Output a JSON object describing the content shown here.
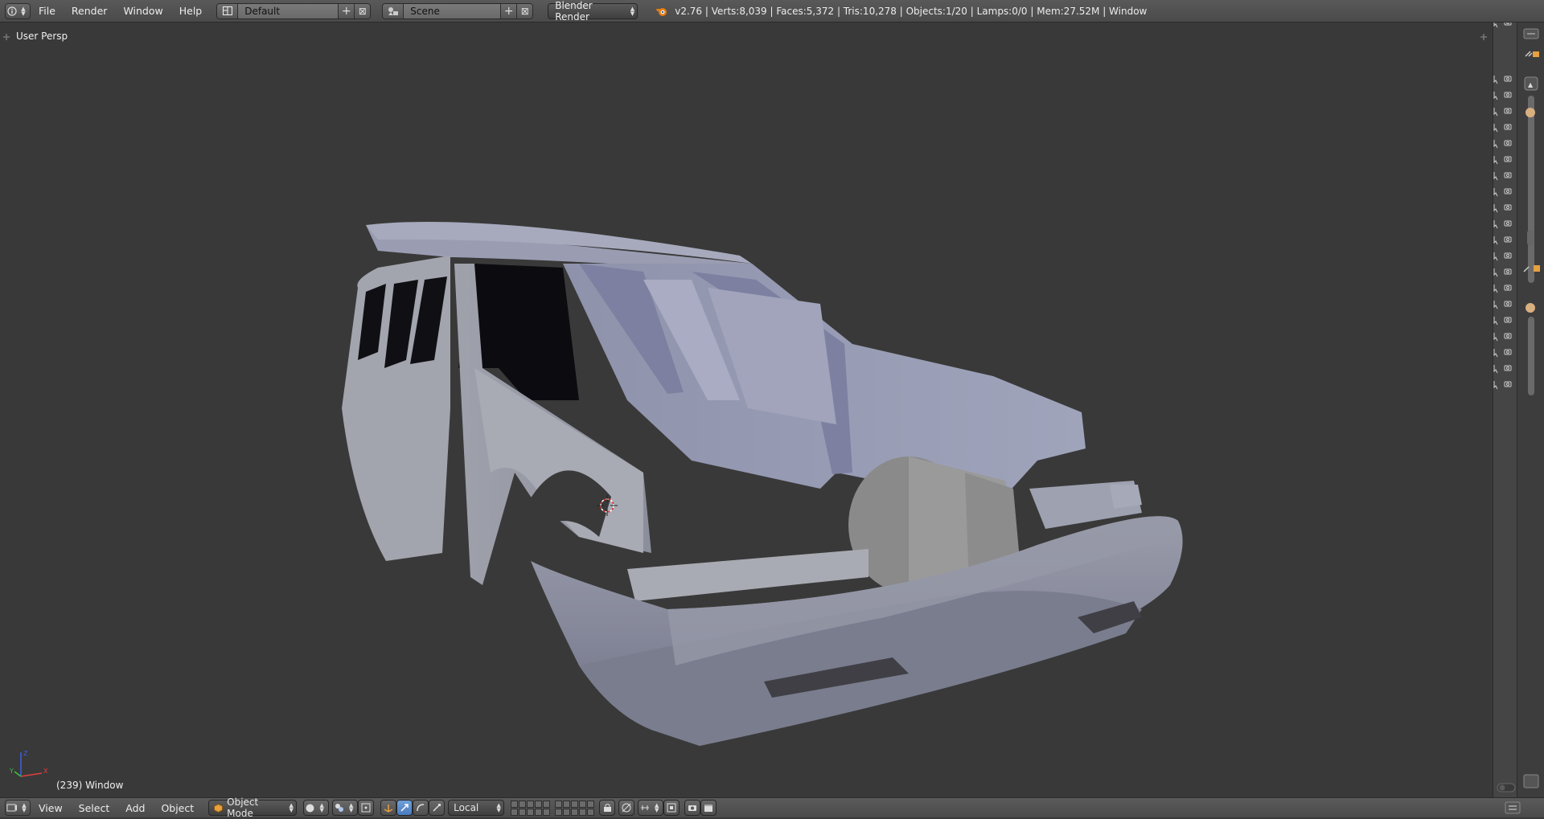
{
  "header": {
    "menus": [
      "File",
      "Render",
      "Window",
      "Help"
    ],
    "screen_layout": "Default",
    "scene": "Scene",
    "render_engine": "Blender Render",
    "stats": "v2.76 | Verts:8,039 | Faces:5,372 | Tris:10,278 | Objects:1/20 | Lamps:0/0 | Mem:27.52M | Window"
  },
  "viewport": {
    "view_label": "User Persp",
    "status_text": "(239) Window",
    "axis": {
      "x": "X",
      "y": "Y",
      "z": "Z"
    }
  },
  "bottom": {
    "menus": [
      "View",
      "Select",
      "Add",
      "Object"
    ],
    "mode": "Object Mode",
    "orientation": "Local"
  },
  "colors": {
    "background": "#393939",
    "header": "#505050",
    "active_blue": "#5680c2",
    "mesh": "#8a8d9e"
  }
}
